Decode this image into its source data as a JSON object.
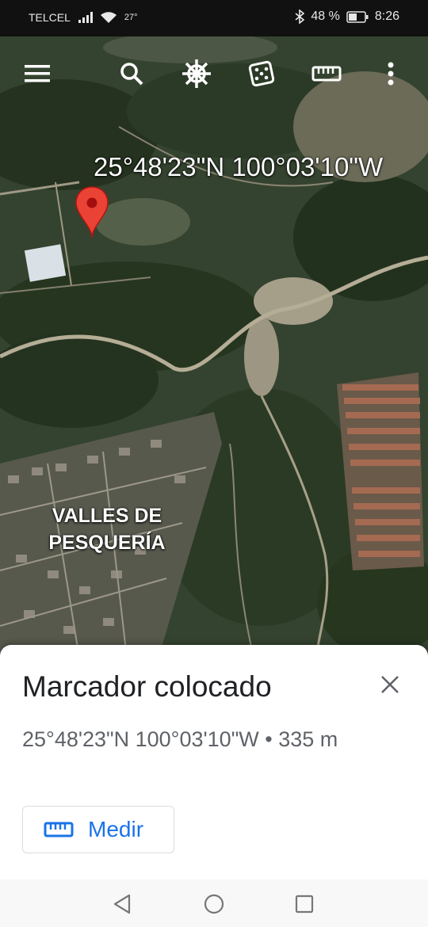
{
  "status_bar": {
    "carrier": "TELCEL",
    "temperature": "27°",
    "battery": "48 %",
    "time": "8:26"
  },
  "toolbar": {
    "icons": [
      "menu-icon",
      "search-icon",
      "voyager-wheel-icon",
      "dice-icon",
      "ruler-icon",
      "more-vert-icon"
    ]
  },
  "map": {
    "coordinates_label": "25°48'23\"N 100°03'10\"W",
    "place_label": "VALLES DE PESQUERÍA",
    "marker_color": "#ea4335"
  },
  "sheet": {
    "title": "Marcador colocado",
    "details": "25°48'23\"N 100°03'10\"W • 335 m",
    "measure_label": "Medir",
    "accent_color": "#1a73e8"
  },
  "nav_bar": {
    "buttons": [
      "back-icon",
      "home-icon",
      "recents-icon"
    ]
  }
}
